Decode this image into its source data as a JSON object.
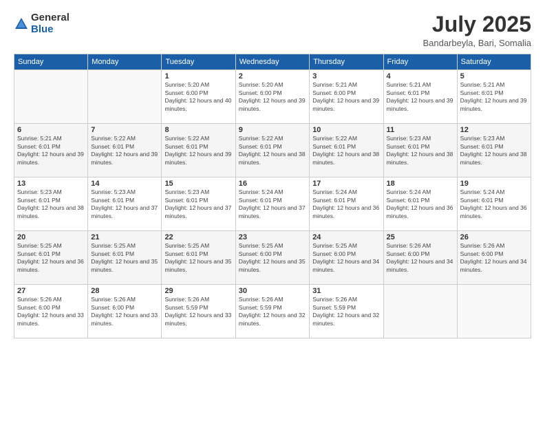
{
  "header": {
    "logo_general": "General",
    "logo_blue": "Blue",
    "title": "July 2025",
    "location": "Bandarbeyla, Bari, Somalia"
  },
  "weekdays": [
    "Sunday",
    "Monday",
    "Tuesday",
    "Wednesday",
    "Thursday",
    "Friday",
    "Saturday"
  ],
  "weeks": [
    [
      {
        "day": "",
        "info": ""
      },
      {
        "day": "",
        "info": ""
      },
      {
        "day": "1",
        "info": "Sunrise: 5:20 AM\nSunset: 6:00 PM\nDaylight: 12 hours and 40 minutes."
      },
      {
        "day": "2",
        "info": "Sunrise: 5:20 AM\nSunset: 6:00 PM\nDaylight: 12 hours and 39 minutes."
      },
      {
        "day": "3",
        "info": "Sunrise: 5:21 AM\nSunset: 6:00 PM\nDaylight: 12 hours and 39 minutes."
      },
      {
        "day": "4",
        "info": "Sunrise: 5:21 AM\nSunset: 6:01 PM\nDaylight: 12 hours and 39 minutes."
      },
      {
        "day": "5",
        "info": "Sunrise: 5:21 AM\nSunset: 6:01 PM\nDaylight: 12 hours and 39 minutes."
      }
    ],
    [
      {
        "day": "6",
        "info": "Sunrise: 5:21 AM\nSunset: 6:01 PM\nDaylight: 12 hours and 39 minutes."
      },
      {
        "day": "7",
        "info": "Sunrise: 5:22 AM\nSunset: 6:01 PM\nDaylight: 12 hours and 39 minutes."
      },
      {
        "day": "8",
        "info": "Sunrise: 5:22 AM\nSunset: 6:01 PM\nDaylight: 12 hours and 39 minutes."
      },
      {
        "day": "9",
        "info": "Sunrise: 5:22 AM\nSunset: 6:01 PM\nDaylight: 12 hours and 38 minutes."
      },
      {
        "day": "10",
        "info": "Sunrise: 5:22 AM\nSunset: 6:01 PM\nDaylight: 12 hours and 38 minutes."
      },
      {
        "day": "11",
        "info": "Sunrise: 5:23 AM\nSunset: 6:01 PM\nDaylight: 12 hours and 38 minutes."
      },
      {
        "day": "12",
        "info": "Sunrise: 5:23 AM\nSunset: 6:01 PM\nDaylight: 12 hours and 38 minutes."
      }
    ],
    [
      {
        "day": "13",
        "info": "Sunrise: 5:23 AM\nSunset: 6:01 PM\nDaylight: 12 hours and 38 minutes."
      },
      {
        "day": "14",
        "info": "Sunrise: 5:23 AM\nSunset: 6:01 PM\nDaylight: 12 hours and 37 minutes."
      },
      {
        "day": "15",
        "info": "Sunrise: 5:23 AM\nSunset: 6:01 PM\nDaylight: 12 hours and 37 minutes."
      },
      {
        "day": "16",
        "info": "Sunrise: 5:24 AM\nSunset: 6:01 PM\nDaylight: 12 hours and 37 minutes."
      },
      {
        "day": "17",
        "info": "Sunrise: 5:24 AM\nSunset: 6:01 PM\nDaylight: 12 hours and 36 minutes."
      },
      {
        "day": "18",
        "info": "Sunrise: 5:24 AM\nSunset: 6:01 PM\nDaylight: 12 hours and 36 minutes."
      },
      {
        "day": "19",
        "info": "Sunrise: 5:24 AM\nSunset: 6:01 PM\nDaylight: 12 hours and 36 minutes."
      }
    ],
    [
      {
        "day": "20",
        "info": "Sunrise: 5:25 AM\nSunset: 6:01 PM\nDaylight: 12 hours and 36 minutes."
      },
      {
        "day": "21",
        "info": "Sunrise: 5:25 AM\nSunset: 6:01 PM\nDaylight: 12 hours and 35 minutes."
      },
      {
        "day": "22",
        "info": "Sunrise: 5:25 AM\nSunset: 6:01 PM\nDaylight: 12 hours and 35 minutes."
      },
      {
        "day": "23",
        "info": "Sunrise: 5:25 AM\nSunset: 6:00 PM\nDaylight: 12 hours and 35 minutes."
      },
      {
        "day": "24",
        "info": "Sunrise: 5:25 AM\nSunset: 6:00 PM\nDaylight: 12 hours and 34 minutes."
      },
      {
        "day": "25",
        "info": "Sunrise: 5:26 AM\nSunset: 6:00 PM\nDaylight: 12 hours and 34 minutes."
      },
      {
        "day": "26",
        "info": "Sunrise: 5:26 AM\nSunset: 6:00 PM\nDaylight: 12 hours and 34 minutes."
      }
    ],
    [
      {
        "day": "27",
        "info": "Sunrise: 5:26 AM\nSunset: 6:00 PM\nDaylight: 12 hours and 33 minutes."
      },
      {
        "day": "28",
        "info": "Sunrise: 5:26 AM\nSunset: 6:00 PM\nDaylight: 12 hours and 33 minutes."
      },
      {
        "day": "29",
        "info": "Sunrise: 5:26 AM\nSunset: 5:59 PM\nDaylight: 12 hours and 33 minutes."
      },
      {
        "day": "30",
        "info": "Sunrise: 5:26 AM\nSunset: 5:59 PM\nDaylight: 12 hours and 32 minutes."
      },
      {
        "day": "31",
        "info": "Sunrise: 5:26 AM\nSunset: 5:59 PM\nDaylight: 12 hours and 32 minutes."
      },
      {
        "day": "",
        "info": ""
      },
      {
        "day": "",
        "info": ""
      }
    ]
  ]
}
